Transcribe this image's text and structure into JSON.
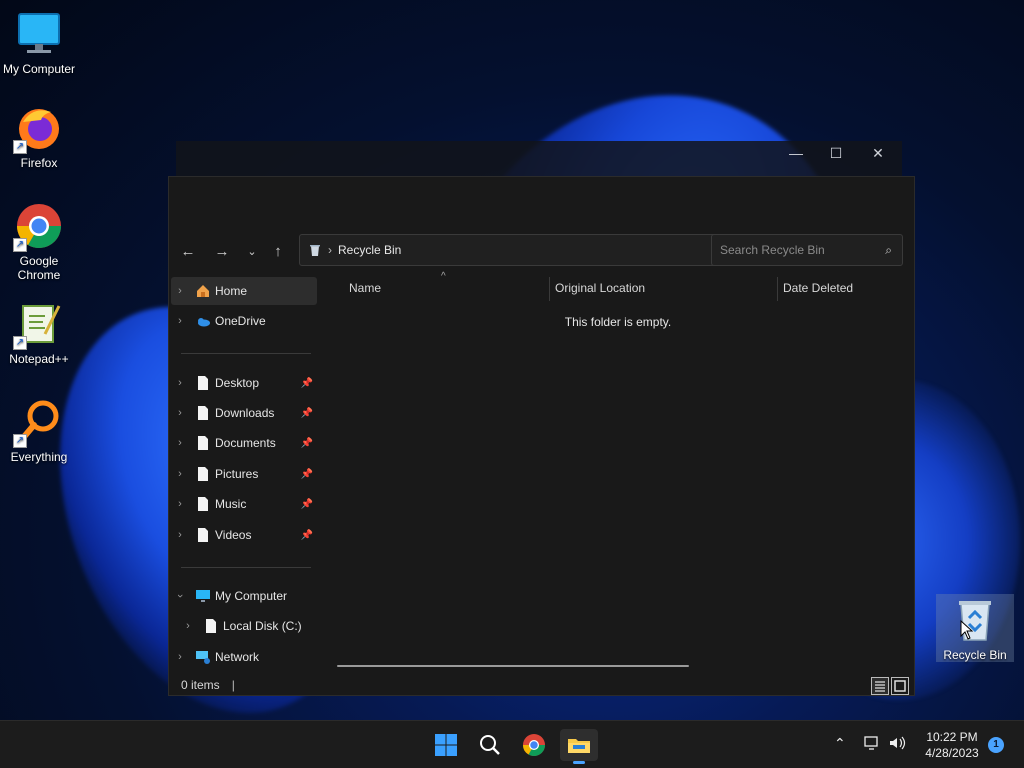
{
  "desktop": {
    "icons": [
      {
        "label": "My Computer"
      },
      {
        "label": "Firefox"
      },
      {
        "label": "Google Chrome"
      },
      {
        "label": "Notepad++"
      },
      {
        "label": "Everything"
      },
      {
        "label": "Recycle Bin"
      }
    ]
  },
  "explorer": {
    "address": {
      "location": "Recycle Bin"
    },
    "search": {
      "placeholder": "Search Recycle Bin"
    },
    "sidebar": {
      "home": "Home",
      "onedrive": "OneDrive",
      "pinned": [
        "Desktop",
        "Downloads",
        "Documents",
        "Pictures",
        "Music",
        "Videos"
      ],
      "my_computer": "My Computer",
      "local_disk": "Local Disk (C:)",
      "network": "Network"
    },
    "columns": [
      "Name",
      "Original Location",
      "Date Deleted"
    ],
    "empty_message": "This folder is empty.",
    "status": "0 items"
  },
  "taskbar": {
    "time": "10:22 PM",
    "date": "4/28/2023",
    "notification_count": "1"
  },
  "colors": {
    "accent": "#4aa3ff",
    "window_bg": "#191919",
    "taskbar_bg": "#1c1c1c"
  }
}
